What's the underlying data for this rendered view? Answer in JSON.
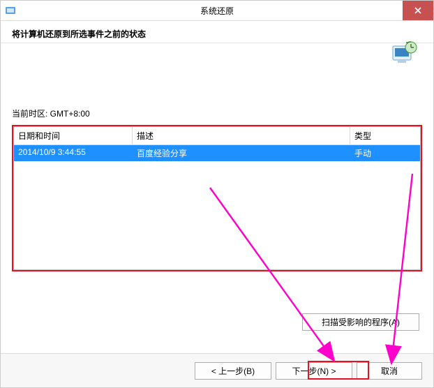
{
  "window": {
    "title": "系统还原"
  },
  "header": {
    "subtitle": "将计算机还原到所选事件之前的状态"
  },
  "timezone": {
    "label": "当前时区: GMT+8:00"
  },
  "columns": {
    "date": "日期和时间",
    "desc": "描述",
    "type": "类型"
  },
  "rows": [
    {
      "date": "2014/10/9 3:44:55",
      "desc": "百度经验分享",
      "type": "手动"
    }
  ],
  "buttons": {
    "scan": "扫描受影响的程序(A)",
    "back": "< 上一步(B)",
    "next": "下一步(N) >",
    "cancel": "取消"
  }
}
